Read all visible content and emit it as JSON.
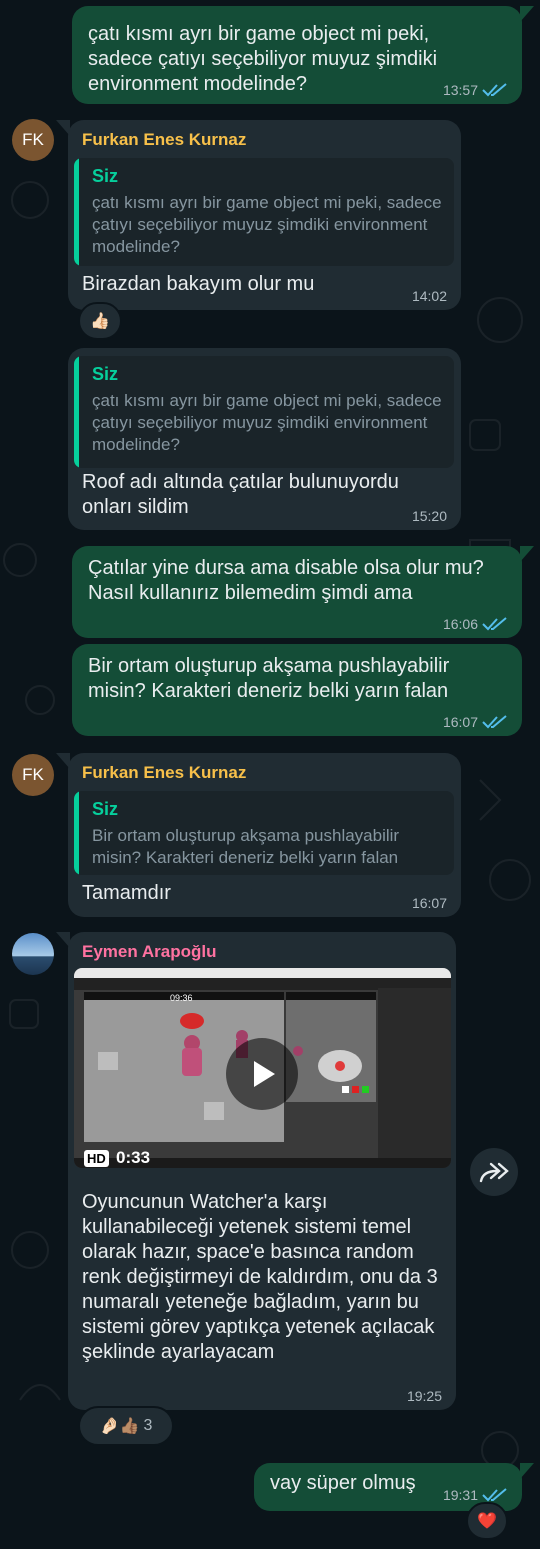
{
  "messages": {
    "m1": {
      "text": "çatı kısmı ayrı bir game object mi peki, sadece çatıyı seçebiliyor muyuz şimdiki environment modelinde?",
      "time": "13:57"
    },
    "m2": {
      "avatar": "FK",
      "sender": "Furkan Enes Kurnaz",
      "quote_name": "Siz",
      "quote_text": "çatı kısmı ayrı bir game object mi peki, sadece çatıyı seçebiliyor muyuz şimdiki environment modelinde?",
      "text": "Birazdan bakayım olur mu",
      "time": "14:02",
      "reaction": "👍🏻"
    },
    "m3": {
      "quote_name": "Siz",
      "quote_text": "çatı kısmı ayrı bir game object mi peki, sadece çatıyı seçebiliyor muyuz şimdiki environment modelinde?",
      "text": "Roof adı altında çatılar bulunuyordu onları sildim",
      "time": "15:20"
    },
    "m4": {
      "text": "Çatılar yine dursa ama disable olsa olur mu? Nasıl kullanırız bilemedim şimdi ama",
      "time": "16:06"
    },
    "m5": {
      "text": "Bir ortam oluşturup akşama pushlayabilir misin? Karakteri deneriz belki yarın falan",
      "time": "16:07"
    },
    "m6": {
      "avatar": "FK",
      "sender": "Furkan Enes Kurnaz",
      "quote_name": "Siz",
      "quote_text": "Bir ortam oluşturup akşama pushlayabilir misin? Karakteri deneriz belki yarın falan",
      "text": "Tamamdır",
      "time": "16:07"
    },
    "m7": {
      "sender": "Eymen Arapoğlu",
      "video_badge": "HD",
      "video_duration": "0:33",
      "video_overlay_time": "09:36",
      "text": "Oyuncunun Watcher'a karşı kullanabileceği yetenek sistemi temel olarak hazır, space'e basınca random renk değiştirmeyi de kaldırdım, onu da 3 numaralı yeteneğe bağladım, yarın bu sistemi görev yaptıkça yetenek açılacak şeklinde ayarlayacam",
      "time": "19:25",
      "reactions": "🤌🏻👍🏽",
      "reaction_count": "3"
    },
    "m8": {
      "text": "vay süper olmuş",
      "time": "19:31",
      "reaction": "❤️"
    }
  },
  "colors": {
    "outgoing": "#144d37",
    "incoming": "#202c33",
    "background": "#0b141a",
    "quote_accent": "#06cf9c",
    "sender_fk": "#f7c04a",
    "sender_eymen": "#ff72a1",
    "read_ticks": "#53bdeb"
  },
  "icons": {
    "read": "double-check-icon",
    "forward": "forward-icon",
    "play": "play-icon"
  }
}
